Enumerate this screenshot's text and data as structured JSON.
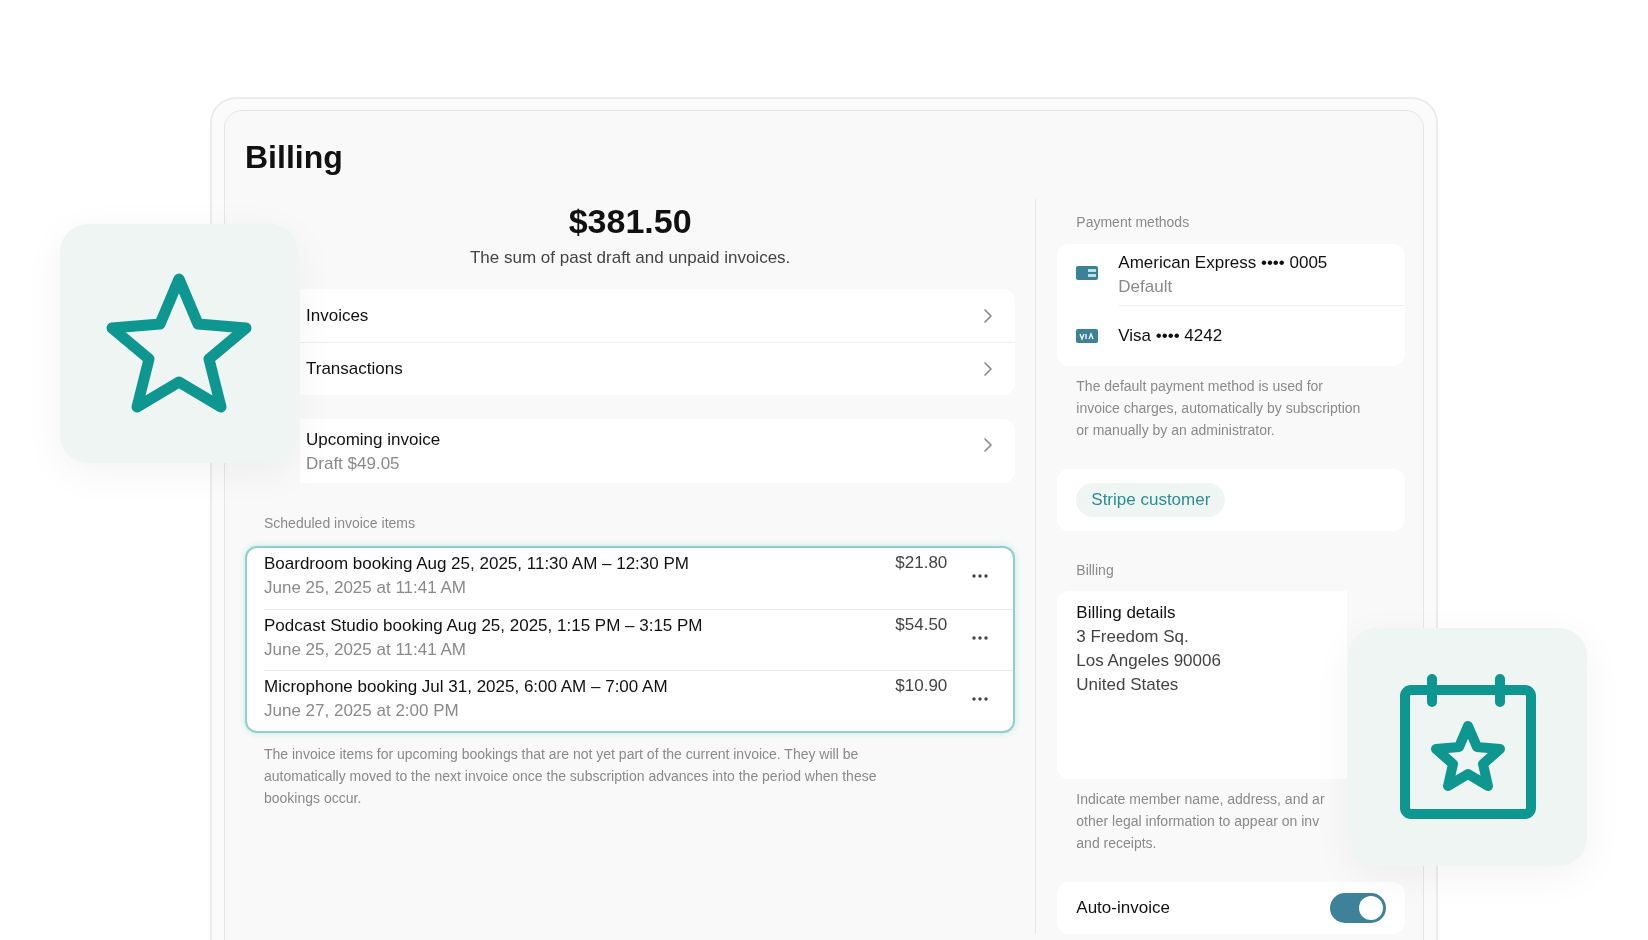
{
  "page_title": "Billing",
  "balance": {
    "amount": "$381.50",
    "caption": "The sum of past draft and unpaid invoices."
  },
  "links": [
    {
      "label": "Invoices"
    },
    {
      "label": "Transactions"
    }
  ],
  "upcoming_invoice": {
    "title": "Upcoming invoice",
    "subtitle": "Draft $49.05"
  },
  "scheduled": {
    "heading": "Scheduled invoice items",
    "items": [
      {
        "title": "Boardroom booking Aug 25, 2025, 11:30 AM – 12:30 PM",
        "date": "June 25, 2025 at 11:41 AM",
        "amount": "$21.80"
      },
      {
        "title": "Podcast Studio booking Aug 25, 2025, 1:15 PM – 3:15 PM",
        "date": "June 25, 2025 at 11:41 AM",
        "amount": "$54.50"
      },
      {
        "title": "Microphone booking Jul 31, 2025, 6:00 AM – 7:00 AM",
        "date": "June 27, 2025 at 2:00 PM",
        "amount": "$10.90"
      }
    ],
    "note": "The invoice items for upcoming bookings that are not yet part of the current invoice. They will be automatically moved to the next invoice once the subscription advances into the period when these bookings occur."
  },
  "payment_methods": {
    "heading": "Payment methods",
    "methods": [
      {
        "kind": "amex",
        "label": "American Express •••• 0005",
        "subtitle": "Default"
      },
      {
        "kind": "visa",
        "label": "Visa •••• 4242"
      }
    ],
    "note": "The default payment method is used for invoice charges, automatically by subscription or manually by an administrator."
  },
  "stripe_customer": {
    "label": "Stripe customer"
  },
  "billing": {
    "heading": "Billing",
    "details": {
      "title": "Billing details",
      "lines": [
        "3 Freedom Sq.",
        "Los Angeles 90006",
        "United States"
      ]
    },
    "note_lines": [
      "Indicate member name, address, and ar",
      "other legal information to appear on inv",
      "and receipts."
    ]
  },
  "auto_invoice": {
    "label": "Auto-invoice",
    "on": true
  }
}
